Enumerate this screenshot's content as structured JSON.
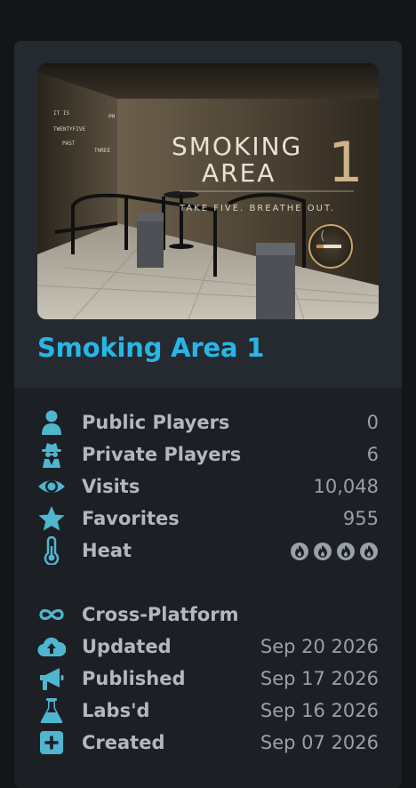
{
  "world": {
    "title": "Smoking Area 1",
    "thumbnail": {
      "main_line1": "SMOKING",
      "main_line2": "AREA",
      "number": "1",
      "tagline": "TAKE FIVE. BREATHE OUT.",
      "wall_text": [
        "IT IS",
        "PM",
        "TWENTYFIVE",
        "PAST",
        "THREE"
      ]
    }
  },
  "stats": [
    {
      "icon": "person-icon",
      "label": "Public Players",
      "value": "0"
    },
    {
      "icon": "spy-icon",
      "label": "Private Players",
      "value": "6"
    },
    {
      "icon": "eye-icon",
      "label": "Visits",
      "value": "10,048"
    },
    {
      "icon": "star-icon",
      "label": "Favorites",
      "value": "955"
    },
    {
      "icon": "thermometer-icon",
      "label": "Heat",
      "value": "",
      "heat_level": 4,
      "heat_max": 4
    }
  ],
  "details": [
    {
      "icon": "infinity-icon",
      "label": "Cross-Platform",
      "value": ""
    },
    {
      "icon": "cloud-upload-icon",
      "label": "Updated",
      "value": "Sep 20 2026"
    },
    {
      "icon": "megaphone-icon",
      "label": "Published",
      "value": "Sep 17 2026"
    },
    {
      "icon": "flask-icon",
      "label": "Labs'd",
      "value": "Sep 16 2026"
    },
    {
      "icon": "plus-square-icon",
      "label": "Created",
      "value": "Sep 07 2026"
    }
  ],
  "colors": {
    "accent": "#27b7e6",
    "icon": "#4fb6d0",
    "label": "#b3b8bf",
    "value": "#9aa0a7",
    "card": "#1c1f24",
    "card_top": "#252a31",
    "page": "#131519"
  }
}
